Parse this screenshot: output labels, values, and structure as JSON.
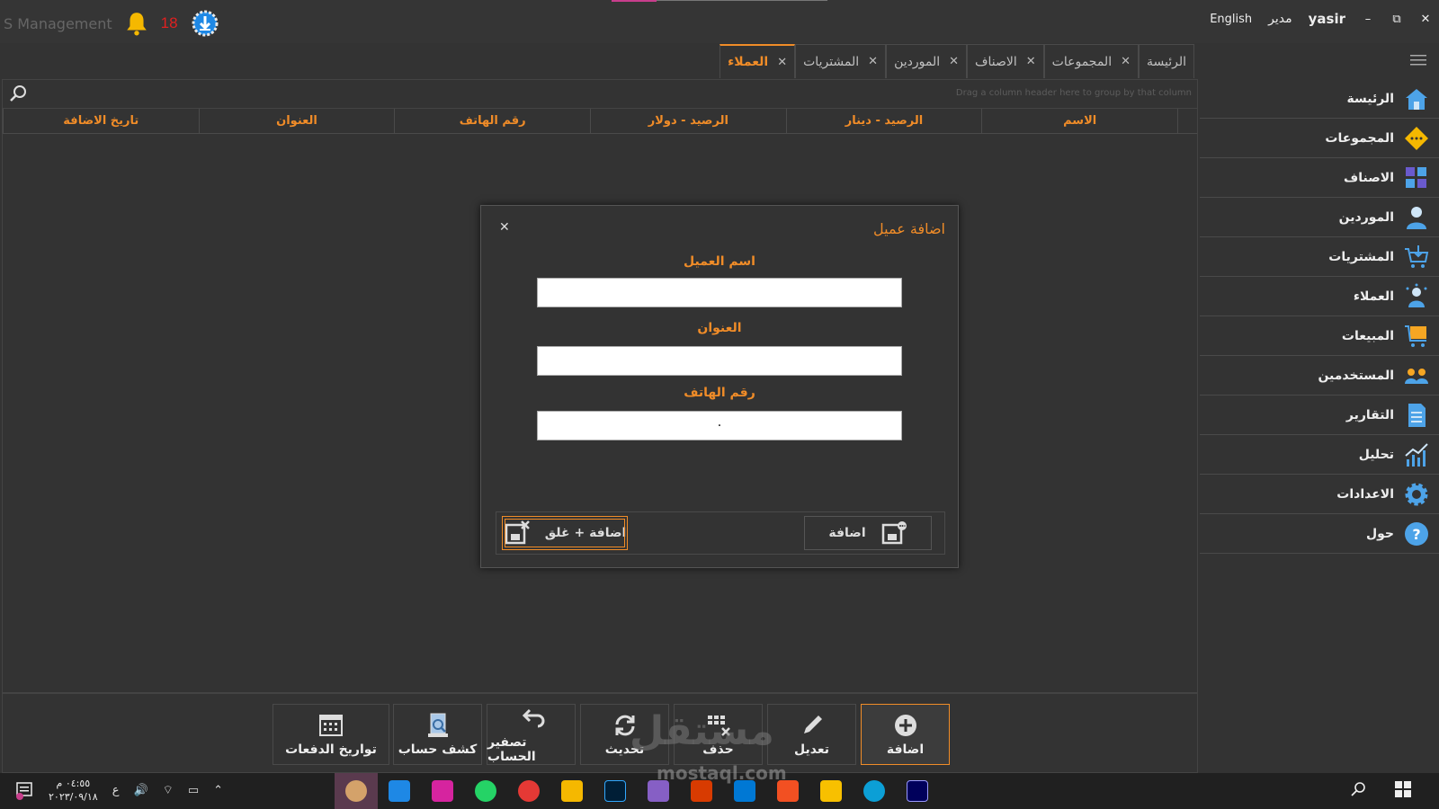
{
  "window": {
    "app_title": "S Management",
    "notification_count": "18",
    "language": "English",
    "role": "مدير",
    "user": "yasir",
    "minimize": "–",
    "maximize": "⧉",
    "close": "✕"
  },
  "tabs": [
    {
      "label": "الرئيسة",
      "closable": false
    },
    {
      "label": "المجموعات",
      "closable": true
    },
    {
      "label": "الاصناف",
      "closable": true
    },
    {
      "label": "الموردين",
      "closable": true
    },
    {
      "label": "المشتريات",
      "closable": true
    },
    {
      "label": "العملاء",
      "closable": true,
      "active": true
    }
  ],
  "tab_close": "✕",
  "grid": {
    "group_hint": "Drag a column header here to group by that column",
    "columns": [
      "الاسم",
      "الرصيد - دينار",
      "الرصيد - دولار",
      "رقم الهاتف",
      "العنوان",
      "تاريخ الاضافة"
    ]
  },
  "dialog": {
    "title": "اضافة عميل",
    "close": "✕",
    "fields": [
      {
        "label": "اسم العميل",
        "value": ""
      },
      {
        "label": "العنوان",
        "value": ""
      },
      {
        "label": "رقم الهاتف",
        "value": "·"
      }
    ],
    "add_button": "اضافة",
    "add_close_button": "اضافة + غلق"
  },
  "toolbar": [
    {
      "label": "اضافة",
      "icon": "plus-circle-icon"
    },
    {
      "label": "تعديل",
      "icon": "pencil-icon"
    },
    {
      "label": "حذف",
      "icon": "delete-grid-icon"
    },
    {
      "label": "تحديث",
      "icon": "refresh-icon"
    },
    {
      "label": "تصفير الحساب",
      "icon": "undo-icon"
    },
    {
      "label": "كشف حساب",
      "icon": "statement-search-icon"
    },
    {
      "label": "تواريخ الدفعات",
      "icon": "calendar-icon"
    }
  ],
  "sidebar": [
    {
      "label": "الرئيسة",
      "icon": "home-icon",
      "color": "#4da3e8"
    },
    {
      "label": "المجموعات",
      "icon": "groups-icon",
      "color": "#f5b800"
    },
    {
      "label": "الاصناف",
      "icon": "categories-icon",
      "color": "#6a5acd"
    },
    {
      "label": "الموردين",
      "icon": "suppliers-icon",
      "color": "#4da3e8"
    },
    {
      "label": "المشتريات",
      "icon": "purchases-cart-icon",
      "color": "#4da3e8"
    },
    {
      "label": "العملاء",
      "icon": "customers-icon",
      "color": "#4da3e8"
    },
    {
      "label": "المبيعات",
      "icon": "sales-cart-icon",
      "color": "#f5a623"
    },
    {
      "label": "المستخدمين",
      "icon": "users-icon",
      "color": "#f5a623"
    },
    {
      "label": "التقارير",
      "icon": "reports-icon",
      "color": "#4da3e8"
    },
    {
      "label": "تحليل",
      "icon": "analysis-chart-icon",
      "color": "#4da3e8"
    },
    {
      "label": "الاعدادات",
      "icon": "settings-gear-icon",
      "color": "#4da3e8"
    },
    {
      "label": "حول",
      "icon": "help-icon",
      "color": "#4da3e8"
    }
  ],
  "taskbar": {
    "time": "٠٤:٥٥ م",
    "date": "٢٠٢٣/٠٩/١٨",
    "input_lang": "ع"
  },
  "watermark": {
    "main": "مستقل",
    "sub": "mostaql.com"
  },
  "colors": {
    "accent": "#f08c28",
    "bg": "#333333",
    "notif": "#e02020"
  }
}
